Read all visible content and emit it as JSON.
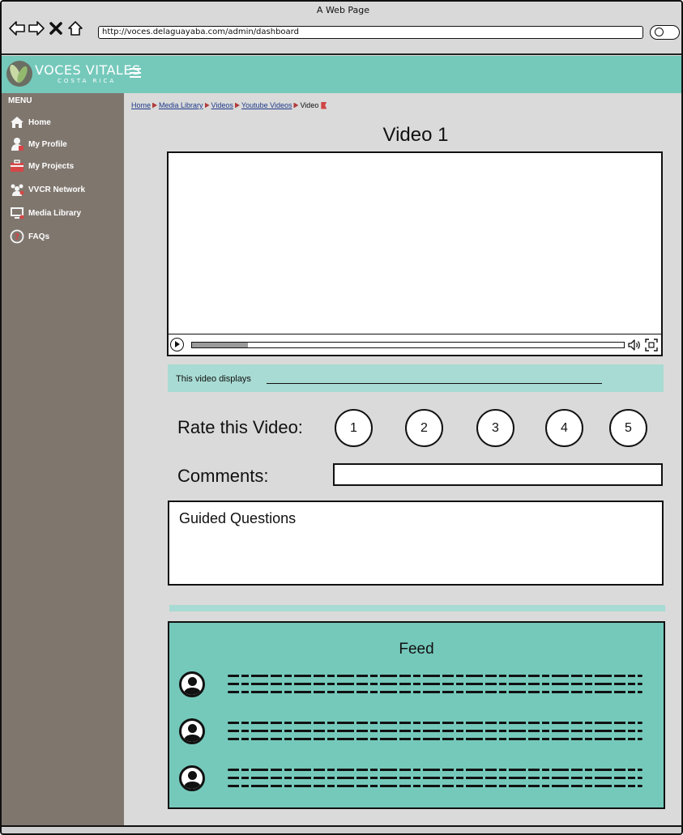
{
  "browser": {
    "title": "A Web Page",
    "url": "http://voces.delaguayaba.com/admin/dashboard"
  },
  "header": {
    "logo_title": "VOCES VITALES",
    "logo_subtitle": "COSTA RICA"
  },
  "sidebar": {
    "menu_label": "MENU",
    "items": [
      {
        "label": "Home",
        "icon": "home-icon"
      },
      {
        "label": "My Profile",
        "icon": "user-icon"
      },
      {
        "label": "My Projects",
        "icon": "briefcase-icon"
      },
      {
        "label": "VVCR Network",
        "icon": "network-icon"
      },
      {
        "label": "Media Library",
        "icon": "monitor-icon"
      },
      {
        "label": "FAQs",
        "icon": "help-icon"
      }
    ]
  },
  "breadcrumb": {
    "items": [
      "Home",
      "Media Library",
      "Videos",
      "Youtube Videos"
    ],
    "current": "Video"
  },
  "main": {
    "title": "Video 1",
    "video": {
      "progress": 0.13
    },
    "description": "This video displays",
    "rate_label": "Rate this Video:",
    "ratings": [
      "1",
      "2",
      "3",
      "4",
      "5"
    ],
    "comments_label": "Comments:",
    "comments_value": "",
    "guided_title": "Guided Questions"
  },
  "feed": {
    "title": "Feed",
    "items": [
      {
        "avatar": "avatar-icon"
      },
      {
        "avatar": "avatar-icon"
      },
      {
        "avatar": "avatar-icon"
      }
    ]
  },
  "colors": {
    "accent": "#75c9bb",
    "accent_light": "#a8dbd3",
    "sidebar": "#7f766e",
    "background": "#dadada"
  }
}
